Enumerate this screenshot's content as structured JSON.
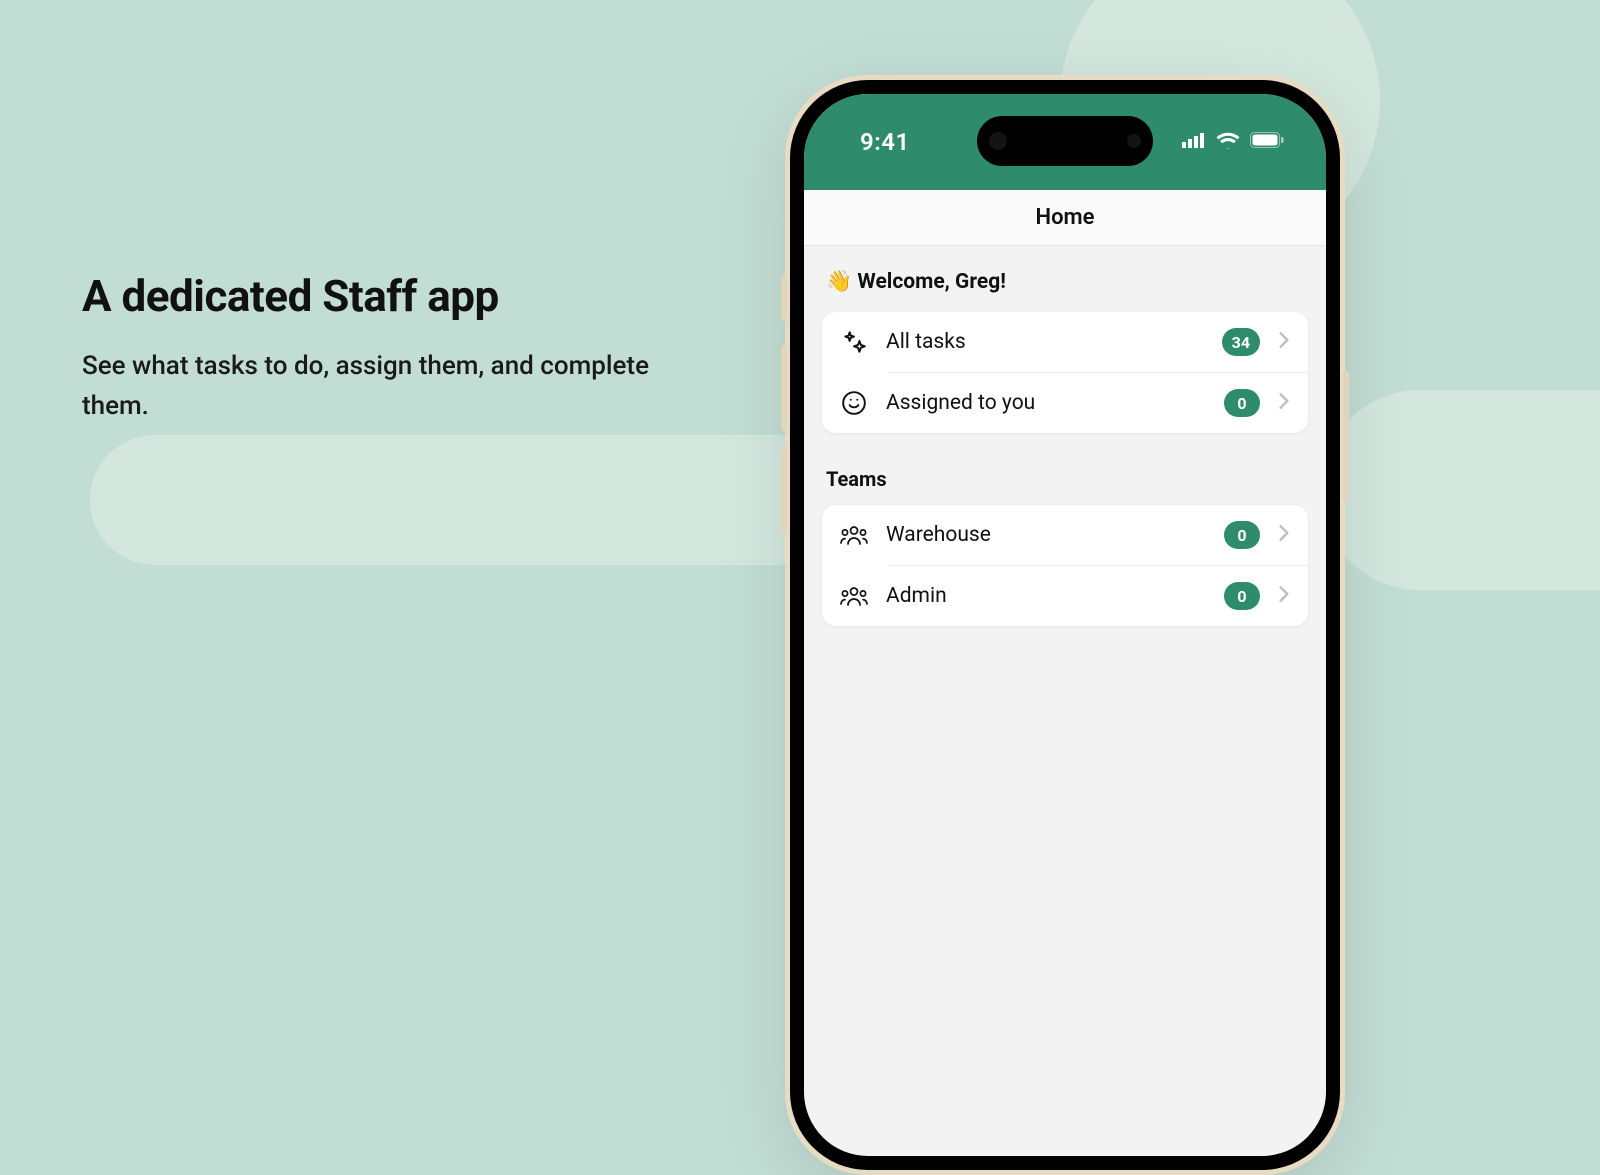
{
  "marketing": {
    "headline": "A dedicated Staff app",
    "subline": "See what tasks to do, assign them, and complete them."
  },
  "status_bar": {
    "time": "9:41"
  },
  "nav": {
    "title": "Home"
  },
  "welcome": {
    "emoji": "👋",
    "text": "Welcome, Greg!"
  },
  "task_rows": [
    {
      "icon": "sparkle",
      "label": "All tasks",
      "count": "34"
    },
    {
      "icon": "smile",
      "label": "Assigned to you",
      "count": "0"
    }
  ],
  "teams_section": {
    "title": "Teams",
    "rows": [
      {
        "icon": "people",
        "label": "Warehouse",
        "count": "0"
      },
      {
        "icon": "people",
        "label": "Admin",
        "count": "0"
      }
    ]
  }
}
